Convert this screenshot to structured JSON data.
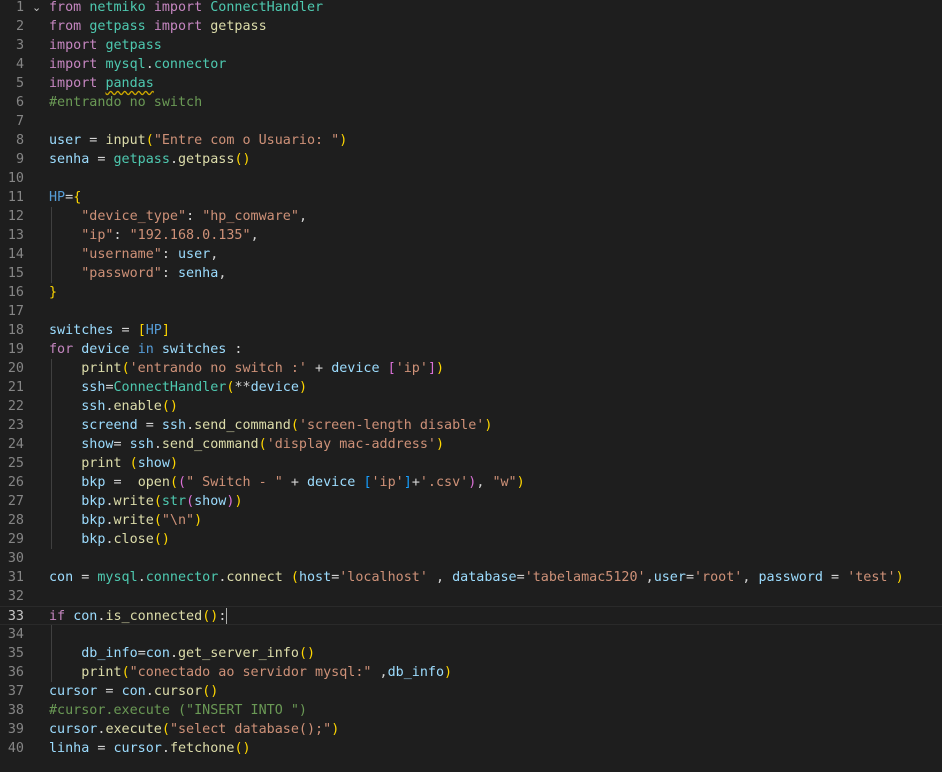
{
  "editor": {
    "language": "python",
    "current_line": 33,
    "lines": [
      {
        "n": 1,
        "fold": "⌄",
        "indent": 0,
        "tokens": [
          [
            "kw",
            "from"
          ],
          [
            "pl",
            " "
          ],
          [
            "type",
            "netmiko"
          ],
          [
            "pl",
            " "
          ],
          [
            "kw",
            "import"
          ],
          [
            "pl",
            " "
          ],
          [
            "type",
            "ConnectHandler"
          ]
        ]
      },
      {
        "n": 2,
        "indent": 0,
        "tokens": [
          [
            "kw",
            "from"
          ],
          [
            "pl",
            " "
          ],
          [
            "type",
            "getpass"
          ],
          [
            "pl",
            " "
          ],
          [
            "kw",
            "import"
          ],
          [
            "pl",
            " "
          ],
          [
            "fn",
            "getpass"
          ]
        ]
      },
      {
        "n": 3,
        "indent": 0,
        "tokens": [
          [
            "kw",
            "import"
          ],
          [
            "pl",
            " "
          ],
          [
            "type",
            "getpass"
          ]
        ]
      },
      {
        "n": 4,
        "indent": 0,
        "tokens": [
          [
            "kw",
            "import"
          ],
          [
            "pl",
            " "
          ],
          [
            "type",
            "mysql"
          ],
          [
            "pl",
            "."
          ],
          [
            "type",
            "connector"
          ]
        ]
      },
      {
        "n": 5,
        "indent": 0,
        "tokens": [
          [
            "kw",
            "import"
          ],
          [
            "pl",
            " "
          ],
          [
            "warn",
            "pandas"
          ]
        ]
      },
      {
        "n": 6,
        "indent": 0,
        "tokens": [
          [
            "cm",
            "#entrando no switch"
          ]
        ]
      },
      {
        "n": 7,
        "indent": 0,
        "tokens": []
      },
      {
        "n": 8,
        "indent": 0,
        "tokens": [
          [
            "var",
            "user"
          ],
          [
            "pl",
            " = "
          ],
          [
            "fn",
            "input"
          ],
          [
            "br1",
            "("
          ],
          [
            "str",
            "\"Entre com o Usuario: \""
          ],
          [
            "br1",
            ")"
          ]
        ]
      },
      {
        "n": 9,
        "indent": 0,
        "tokens": [
          [
            "var",
            "senha"
          ],
          [
            "pl",
            " = "
          ],
          [
            "type",
            "getpass"
          ],
          [
            "pl",
            "."
          ],
          [
            "fn",
            "getpass"
          ],
          [
            "br1",
            "()"
          ]
        ]
      },
      {
        "n": 10,
        "indent": 0,
        "tokens": []
      },
      {
        "n": 11,
        "indent": 0,
        "tokens": [
          [
            "kb",
            "HP"
          ],
          [
            "pl",
            "="
          ],
          [
            "br1",
            "{"
          ]
        ]
      },
      {
        "n": 12,
        "indent": 1,
        "tokens": [
          [
            "pl",
            "    "
          ],
          [
            "str",
            "\"device_type\""
          ],
          [
            "pl",
            ": "
          ],
          [
            "str",
            "\"hp_comware\""
          ],
          [
            "pl",
            ","
          ]
        ]
      },
      {
        "n": 13,
        "indent": 1,
        "tokens": [
          [
            "pl",
            "    "
          ],
          [
            "str",
            "\"ip\""
          ],
          [
            "pl",
            ": "
          ],
          [
            "str",
            "\"192.168.0.135\""
          ],
          [
            "pl",
            ","
          ]
        ]
      },
      {
        "n": 14,
        "indent": 1,
        "tokens": [
          [
            "pl",
            "    "
          ],
          [
            "str",
            "\"username\""
          ],
          [
            "pl",
            ": "
          ],
          [
            "var",
            "user"
          ],
          [
            "pl",
            ","
          ]
        ]
      },
      {
        "n": 15,
        "indent": 1,
        "tokens": [
          [
            "pl",
            "    "
          ],
          [
            "str",
            "\"password\""
          ],
          [
            "pl",
            ": "
          ],
          [
            "var",
            "senha"
          ],
          [
            "pl",
            ","
          ]
        ]
      },
      {
        "n": 16,
        "indent": 0,
        "tokens": [
          [
            "br1",
            "}"
          ]
        ]
      },
      {
        "n": 17,
        "indent": 0,
        "tokens": []
      },
      {
        "n": 18,
        "indent": 0,
        "tokens": [
          [
            "var",
            "switches"
          ],
          [
            "pl",
            " = "
          ],
          [
            "br1",
            "["
          ],
          [
            "kb",
            "HP"
          ],
          [
            "br1",
            "]"
          ]
        ]
      },
      {
        "n": 19,
        "indent": 0,
        "tokens": [
          [
            "kw",
            "for"
          ],
          [
            "pl",
            " "
          ],
          [
            "var",
            "device"
          ],
          [
            "pl",
            " "
          ],
          [
            "kb",
            "in"
          ],
          [
            "pl",
            " "
          ],
          [
            "var",
            "switches"
          ],
          [
            "pl",
            " :"
          ]
        ]
      },
      {
        "n": 20,
        "indent": 1,
        "tokens": [
          [
            "pl",
            "    "
          ],
          [
            "fn",
            "print"
          ],
          [
            "br1",
            "("
          ],
          [
            "str",
            "'entrando no switch :'"
          ],
          [
            "pl",
            " + "
          ],
          [
            "var",
            "device"
          ],
          [
            "pl",
            " "
          ],
          [
            "br2",
            "["
          ],
          [
            "str",
            "'ip'"
          ],
          [
            "br2",
            "]"
          ],
          [
            "br1",
            ")"
          ]
        ]
      },
      {
        "n": 21,
        "indent": 1,
        "tokens": [
          [
            "pl",
            "    "
          ],
          [
            "var",
            "ssh"
          ],
          [
            "pl",
            "="
          ],
          [
            "type",
            "ConnectHandler"
          ],
          [
            "br1",
            "("
          ],
          [
            "pl",
            "**"
          ],
          [
            "var",
            "device"
          ],
          [
            "br1",
            ")"
          ]
        ]
      },
      {
        "n": 22,
        "indent": 1,
        "tokens": [
          [
            "pl",
            "    "
          ],
          [
            "var",
            "ssh"
          ],
          [
            "pl",
            "."
          ],
          [
            "fn",
            "enable"
          ],
          [
            "br1",
            "()"
          ]
        ]
      },
      {
        "n": 23,
        "indent": 1,
        "tokens": [
          [
            "pl",
            "    "
          ],
          [
            "var",
            "screend"
          ],
          [
            "pl",
            " = "
          ],
          [
            "var",
            "ssh"
          ],
          [
            "pl",
            "."
          ],
          [
            "fn",
            "send_command"
          ],
          [
            "br1",
            "("
          ],
          [
            "str",
            "'screen-length disable'"
          ],
          [
            "br1",
            ")"
          ]
        ]
      },
      {
        "n": 24,
        "indent": 1,
        "tokens": [
          [
            "pl",
            "    "
          ],
          [
            "var",
            "show"
          ],
          [
            "pl",
            "= "
          ],
          [
            "var",
            "ssh"
          ],
          [
            "pl",
            "."
          ],
          [
            "fn",
            "send_command"
          ],
          [
            "br1",
            "("
          ],
          [
            "str",
            "'display mac-address'"
          ],
          [
            "br1",
            ")"
          ]
        ]
      },
      {
        "n": 25,
        "indent": 1,
        "tokens": [
          [
            "pl",
            "    "
          ],
          [
            "fn",
            "print"
          ],
          [
            "pl",
            " "
          ],
          [
            "br1",
            "("
          ],
          [
            "var",
            "show"
          ],
          [
            "br1",
            ")"
          ]
        ]
      },
      {
        "n": 26,
        "indent": 1,
        "tokens": [
          [
            "pl",
            "    "
          ],
          [
            "var",
            "bkp"
          ],
          [
            "pl",
            " =  "
          ],
          [
            "fn",
            "open"
          ],
          [
            "br1",
            "("
          ],
          [
            "br2",
            "("
          ],
          [
            "str",
            "\" Switch - \""
          ],
          [
            "pl",
            " + "
          ],
          [
            "var",
            "device"
          ],
          [
            "pl",
            " "
          ],
          [
            "br3",
            "["
          ],
          [
            "str",
            "'ip'"
          ],
          [
            "br3",
            "]"
          ],
          [
            "pl",
            "+"
          ],
          [
            "str",
            "'.csv'"
          ],
          [
            "br2",
            ")"
          ],
          [
            "pl",
            ", "
          ],
          [
            "str",
            "\"w\""
          ],
          [
            "br1",
            ")"
          ]
        ]
      },
      {
        "n": 27,
        "indent": 1,
        "tokens": [
          [
            "pl",
            "    "
          ],
          [
            "var",
            "bkp"
          ],
          [
            "pl",
            "."
          ],
          [
            "fn",
            "write"
          ],
          [
            "br1",
            "("
          ],
          [
            "type",
            "str"
          ],
          [
            "br2",
            "("
          ],
          [
            "var",
            "show"
          ],
          [
            "br2",
            ")"
          ],
          [
            "br1",
            ")"
          ]
        ]
      },
      {
        "n": 28,
        "indent": 1,
        "tokens": [
          [
            "pl",
            "    "
          ],
          [
            "var",
            "bkp"
          ],
          [
            "pl",
            "."
          ],
          [
            "fn",
            "write"
          ],
          [
            "br1",
            "("
          ],
          [
            "str",
            "\"\\n\""
          ],
          [
            "br1",
            ")"
          ]
        ]
      },
      {
        "n": 29,
        "indent": 1,
        "tokens": [
          [
            "pl",
            "    "
          ],
          [
            "var",
            "bkp"
          ],
          [
            "pl",
            "."
          ],
          [
            "fn",
            "close"
          ],
          [
            "br1",
            "()"
          ]
        ]
      },
      {
        "n": 30,
        "indent": 0,
        "tokens": []
      },
      {
        "n": 31,
        "indent": 0,
        "tokens": [
          [
            "var",
            "con"
          ],
          [
            "pl",
            " = "
          ],
          [
            "type",
            "mysql"
          ],
          [
            "pl",
            "."
          ],
          [
            "type",
            "connector"
          ],
          [
            "pl",
            "."
          ],
          [
            "fn",
            "connect"
          ],
          [
            "pl",
            " "
          ],
          [
            "br1",
            "("
          ],
          [
            "var",
            "host"
          ],
          [
            "pl",
            "="
          ],
          [
            "str",
            "'localhost'"
          ],
          [
            "pl",
            " , "
          ],
          [
            "var",
            "database"
          ],
          [
            "pl",
            "="
          ],
          [
            "str",
            "'tabelamac5120'"
          ],
          [
            "pl",
            ","
          ],
          [
            "var",
            "user"
          ],
          [
            "pl",
            "="
          ],
          [
            "str",
            "'root'"
          ],
          [
            "pl",
            ", "
          ],
          [
            "var",
            "password"
          ],
          [
            "pl",
            " = "
          ],
          [
            "str",
            "'test'"
          ],
          [
            "br1",
            ")"
          ]
        ]
      },
      {
        "n": 32,
        "indent": 0,
        "tokens": []
      },
      {
        "n": 33,
        "indent": 0,
        "tokens": [
          [
            "kw",
            "if"
          ],
          [
            "pl",
            " "
          ],
          [
            "var",
            "con"
          ],
          [
            "pl",
            "."
          ],
          [
            "fn",
            "is_connected"
          ],
          [
            "br1",
            "()"
          ],
          [
            "pl",
            ":"
          ],
          [
            "caret",
            ""
          ]
        ]
      },
      {
        "n": 34,
        "indent": 1,
        "tokens": []
      },
      {
        "n": 35,
        "indent": 1,
        "tokens": [
          [
            "pl",
            "    "
          ],
          [
            "var",
            "db_info"
          ],
          [
            "pl",
            "="
          ],
          [
            "var",
            "con"
          ],
          [
            "pl",
            "."
          ],
          [
            "fn",
            "get_server_info"
          ],
          [
            "br1",
            "()"
          ]
        ]
      },
      {
        "n": 36,
        "indent": 1,
        "tokens": [
          [
            "pl",
            "    "
          ],
          [
            "fn",
            "print"
          ],
          [
            "br1",
            "("
          ],
          [
            "str",
            "\"conectado ao servidor mysql:\""
          ],
          [
            "pl",
            " ,"
          ],
          [
            "var",
            "db_info"
          ],
          [
            "br1",
            ")"
          ]
        ]
      },
      {
        "n": 37,
        "indent": 0,
        "tokens": [
          [
            "var",
            "cursor"
          ],
          [
            "pl",
            " = "
          ],
          [
            "var",
            "con"
          ],
          [
            "pl",
            "."
          ],
          [
            "fn",
            "cursor"
          ],
          [
            "br1",
            "()"
          ]
        ]
      },
      {
        "n": 38,
        "indent": 0,
        "tokens": [
          [
            "cm",
            "#cursor.execute (\"INSERT INTO \")"
          ]
        ]
      },
      {
        "n": 39,
        "indent": 0,
        "tokens": [
          [
            "var",
            "cursor"
          ],
          [
            "pl",
            "."
          ],
          [
            "fn",
            "execute"
          ],
          [
            "br1",
            "("
          ],
          [
            "str",
            "\"select database();\""
          ],
          [
            "br1",
            ")"
          ]
        ]
      },
      {
        "n": 40,
        "indent": 0,
        "tokens": [
          [
            "var",
            "linha"
          ],
          [
            "pl",
            " = "
          ],
          [
            "var",
            "cursor"
          ],
          [
            "pl",
            "."
          ],
          [
            "fn",
            "fetchone"
          ],
          [
            "br1",
            "()"
          ]
        ]
      }
    ]
  },
  "colors": {
    "background": "#1e1e1e",
    "keyword": "#c586c0",
    "string": "#ce9178",
    "comment": "#6a9955",
    "variable": "#9cdcfe",
    "function": "#dcdcaa"
  }
}
